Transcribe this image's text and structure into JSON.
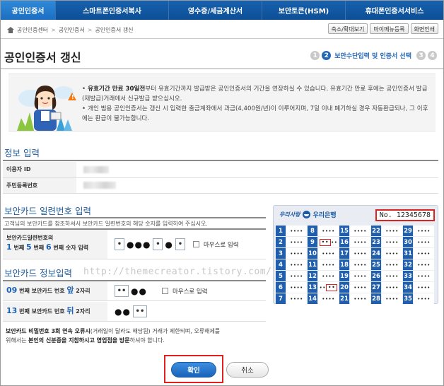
{
  "nav": {
    "tabs": [
      {
        "label": "공인인증서",
        "active": true
      },
      {
        "label": "스마트폰인증서복사",
        "active": false
      },
      {
        "label": "영수증/세금계산서",
        "active": false
      },
      {
        "label": "보안토큰(HSM)",
        "active": false
      },
      {
        "label": "휴대폰인증서서비스",
        "active": false
      }
    ]
  },
  "breadcrumb": [
    "공인인증센터",
    "공인인증서",
    "공인인증서 갱신"
  ],
  "tools": {
    "zoom": "축소/확대보기",
    "my_menu": "마이메뉴등록",
    "print": "화면인쇄"
  },
  "page": {
    "title": "공인인증서 갱신"
  },
  "steps": {
    "items": [
      "1",
      "2",
      "3",
      "4"
    ],
    "current": 2,
    "current_label": "보안수단입력 및 인증서 선택"
  },
  "notice": {
    "line1_bold": "유효기간 만료 30일전",
    "line1_rest": "부터 유효기간까지 발급받은 공인인증서의 기간을 연장하실 수 있습니다. 유효기간 만료 후에는 공인인증서 발급(재발급)거래에서 신규발급 받으십시오.",
    "line2": "개인 범용 공인인증서는 갱신 시 입력한 출금계좌에서 과금(4,400원/년)이 이루어지며, 7일 이내 폐기하실 경우 자동환급되나, 그 이후에는 환급이 불가능합니다."
  },
  "info": {
    "title": "정보 입력",
    "rows": [
      {
        "label": "이용자 ID"
      },
      {
        "label": "주민등록번호"
      }
    ]
  },
  "serial_section": {
    "title": "보안카드 일련번호 입력",
    "desc": "고객님의 보안카드를 참조하셔서 보안카드 일련번호의 해당 숫자를 입력하여 주십시오.",
    "row_label_top": "보안카드일련번호의",
    "pos1": "1",
    "pos1_unit": "번째",
    "pos2": "5",
    "pos2_unit": "번째",
    "pos3": "6",
    "pos3_unit": "번째 숫자 입력",
    "cell1": "•",
    "dots1": "●●●",
    "cell2": "•",
    "dots2": "●",
    "cell3": "•",
    "mouse_label": "마우스로 입력"
  },
  "card_section": {
    "title": "보안카드 정보입력",
    "row1_num": "09",
    "row1_text1": "번째 보안카드 번호",
    "row1_pos": "앞",
    "row1_text2": "2자리",
    "row1_cell": "••",
    "row1_dots": "●●",
    "row2_num": "13",
    "row2_text1": "번째 보안카드 번호",
    "row2_pos": "뒤",
    "row2_text2": "2자리",
    "row2_dots": "●●",
    "row2_cell": "••",
    "mouse_label": "마우스로 입력"
  },
  "watermark": "http://themecreator.tistory.com/",
  "security_card": {
    "bank_script": "우리사랑",
    "bank_name": "우리은행",
    "serial": "No. 12345678",
    "numbers": [
      1,
      8,
      15,
      22,
      29,
      2,
      9,
      16,
      23,
      30,
      3,
      10,
      17,
      24,
      31,
      4,
      11,
      18,
      25,
      32,
      5,
      12,
      19,
      26,
      33,
      6,
      13,
      20,
      27,
      34,
      7,
      14,
      21,
      28,
      35
    ],
    "mask": "••••",
    "highlight_value": "••"
  },
  "warning": {
    "p1_bold": "보안카드 비밀번호 3회 연속 오류시",
    "p1_rest": "(거래일이 달라도 해당됨) 거래가 제한되며, 오류해제를",
    "p2_pre": "위해서는",
    "p2_bold": "본인의 신분증을 지참하시고 영업점을 방문",
    "p2_rest": "하셔야 합니다."
  },
  "buttons": {
    "ok": "확인",
    "cancel": "취소"
  }
}
